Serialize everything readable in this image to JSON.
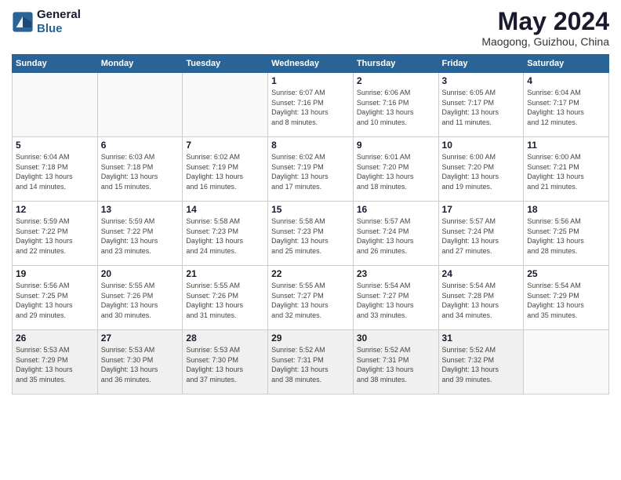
{
  "logo": {
    "line1": "General",
    "line2": "Blue"
  },
  "title": "May 2024",
  "location": "Maogong, Guizhou, China",
  "weekdays": [
    "Sunday",
    "Monday",
    "Tuesday",
    "Wednesday",
    "Thursday",
    "Friday",
    "Saturday"
  ],
  "weeks": [
    [
      {
        "day": "",
        "info": ""
      },
      {
        "day": "",
        "info": ""
      },
      {
        "day": "",
        "info": ""
      },
      {
        "day": "1",
        "info": "Sunrise: 6:07 AM\nSunset: 7:16 PM\nDaylight: 13 hours\nand 8 minutes."
      },
      {
        "day": "2",
        "info": "Sunrise: 6:06 AM\nSunset: 7:16 PM\nDaylight: 13 hours\nand 10 minutes."
      },
      {
        "day": "3",
        "info": "Sunrise: 6:05 AM\nSunset: 7:17 PM\nDaylight: 13 hours\nand 11 minutes."
      },
      {
        "day": "4",
        "info": "Sunrise: 6:04 AM\nSunset: 7:17 PM\nDaylight: 13 hours\nand 12 minutes."
      }
    ],
    [
      {
        "day": "5",
        "info": "Sunrise: 6:04 AM\nSunset: 7:18 PM\nDaylight: 13 hours\nand 14 minutes."
      },
      {
        "day": "6",
        "info": "Sunrise: 6:03 AM\nSunset: 7:18 PM\nDaylight: 13 hours\nand 15 minutes."
      },
      {
        "day": "7",
        "info": "Sunrise: 6:02 AM\nSunset: 7:19 PM\nDaylight: 13 hours\nand 16 minutes."
      },
      {
        "day": "8",
        "info": "Sunrise: 6:02 AM\nSunset: 7:19 PM\nDaylight: 13 hours\nand 17 minutes."
      },
      {
        "day": "9",
        "info": "Sunrise: 6:01 AM\nSunset: 7:20 PM\nDaylight: 13 hours\nand 18 minutes."
      },
      {
        "day": "10",
        "info": "Sunrise: 6:00 AM\nSunset: 7:20 PM\nDaylight: 13 hours\nand 19 minutes."
      },
      {
        "day": "11",
        "info": "Sunrise: 6:00 AM\nSunset: 7:21 PM\nDaylight: 13 hours\nand 21 minutes."
      }
    ],
    [
      {
        "day": "12",
        "info": "Sunrise: 5:59 AM\nSunset: 7:22 PM\nDaylight: 13 hours\nand 22 minutes."
      },
      {
        "day": "13",
        "info": "Sunrise: 5:59 AM\nSunset: 7:22 PM\nDaylight: 13 hours\nand 23 minutes."
      },
      {
        "day": "14",
        "info": "Sunrise: 5:58 AM\nSunset: 7:23 PM\nDaylight: 13 hours\nand 24 minutes."
      },
      {
        "day": "15",
        "info": "Sunrise: 5:58 AM\nSunset: 7:23 PM\nDaylight: 13 hours\nand 25 minutes."
      },
      {
        "day": "16",
        "info": "Sunrise: 5:57 AM\nSunset: 7:24 PM\nDaylight: 13 hours\nand 26 minutes."
      },
      {
        "day": "17",
        "info": "Sunrise: 5:57 AM\nSunset: 7:24 PM\nDaylight: 13 hours\nand 27 minutes."
      },
      {
        "day": "18",
        "info": "Sunrise: 5:56 AM\nSunset: 7:25 PM\nDaylight: 13 hours\nand 28 minutes."
      }
    ],
    [
      {
        "day": "19",
        "info": "Sunrise: 5:56 AM\nSunset: 7:25 PM\nDaylight: 13 hours\nand 29 minutes."
      },
      {
        "day": "20",
        "info": "Sunrise: 5:55 AM\nSunset: 7:26 PM\nDaylight: 13 hours\nand 30 minutes."
      },
      {
        "day": "21",
        "info": "Sunrise: 5:55 AM\nSunset: 7:26 PM\nDaylight: 13 hours\nand 31 minutes."
      },
      {
        "day": "22",
        "info": "Sunrise: 5:55 AM\nSunset: 7:27 PM\nDaylight: 13 hours\nand 32 minutes."
      },
      {
        "day": "23",
        "info": "Sunrise: 5:54 AM\nSunset: 7:27 PM\nDaylight: 13 hours\nand 33 minutes."
      },
      {
        "day": "24",
        "info": "Sunrise: 5:54 AM\nSunset: 7:28 PM\nDaylight: 13 hours\nand 34 minutes."
      },
      {
        "day": "25",
        "info": "Sunrise: 5:54 AM\nSunset: 7:29 PM\nDaylight: 13 hours\nand 35 minutes."
      }
    ],
    [
      {
        "day": "26",
        "info": "Sunrise: 5:53 AM\nSunset: 7:29 PM\nDaylight: 13 hours\nand 35 minutes."
      },
      {
        "day": "27",
        "info": "Sunrise: 5:53 AM\nSunset: 7:30 PM\nDaylight: 13 hours\nand 36 minutes."
      },
      {
        "day": "28",
        "info": "Sunrise: 5:53 AM\nSunset: 7:30 PM\nDaylight: 13 hours\nand 37 minutes."
      },
      {
        "day": "29",
        "info": "Sunrise: 5:52 AM\nSunset: 7:31 PM\nDaylight: 13 hours\nand 38 minutes."
      },
      {
        "day": "30",
        "info": "Sunrise: 5:52 AM\nSunset: 7:31 PM\nDaylight: 13 hours\nand 38 minutes."
      },
      {
        "day": "31",
        "info": "Sunrise: 5:52 AM\nSunset: 7:32 PM\nDaylight: 13 hours\nand 39 minutes."
      },
      {
        "day": "",
        "info": ""
      }
    ]
  ]
}
